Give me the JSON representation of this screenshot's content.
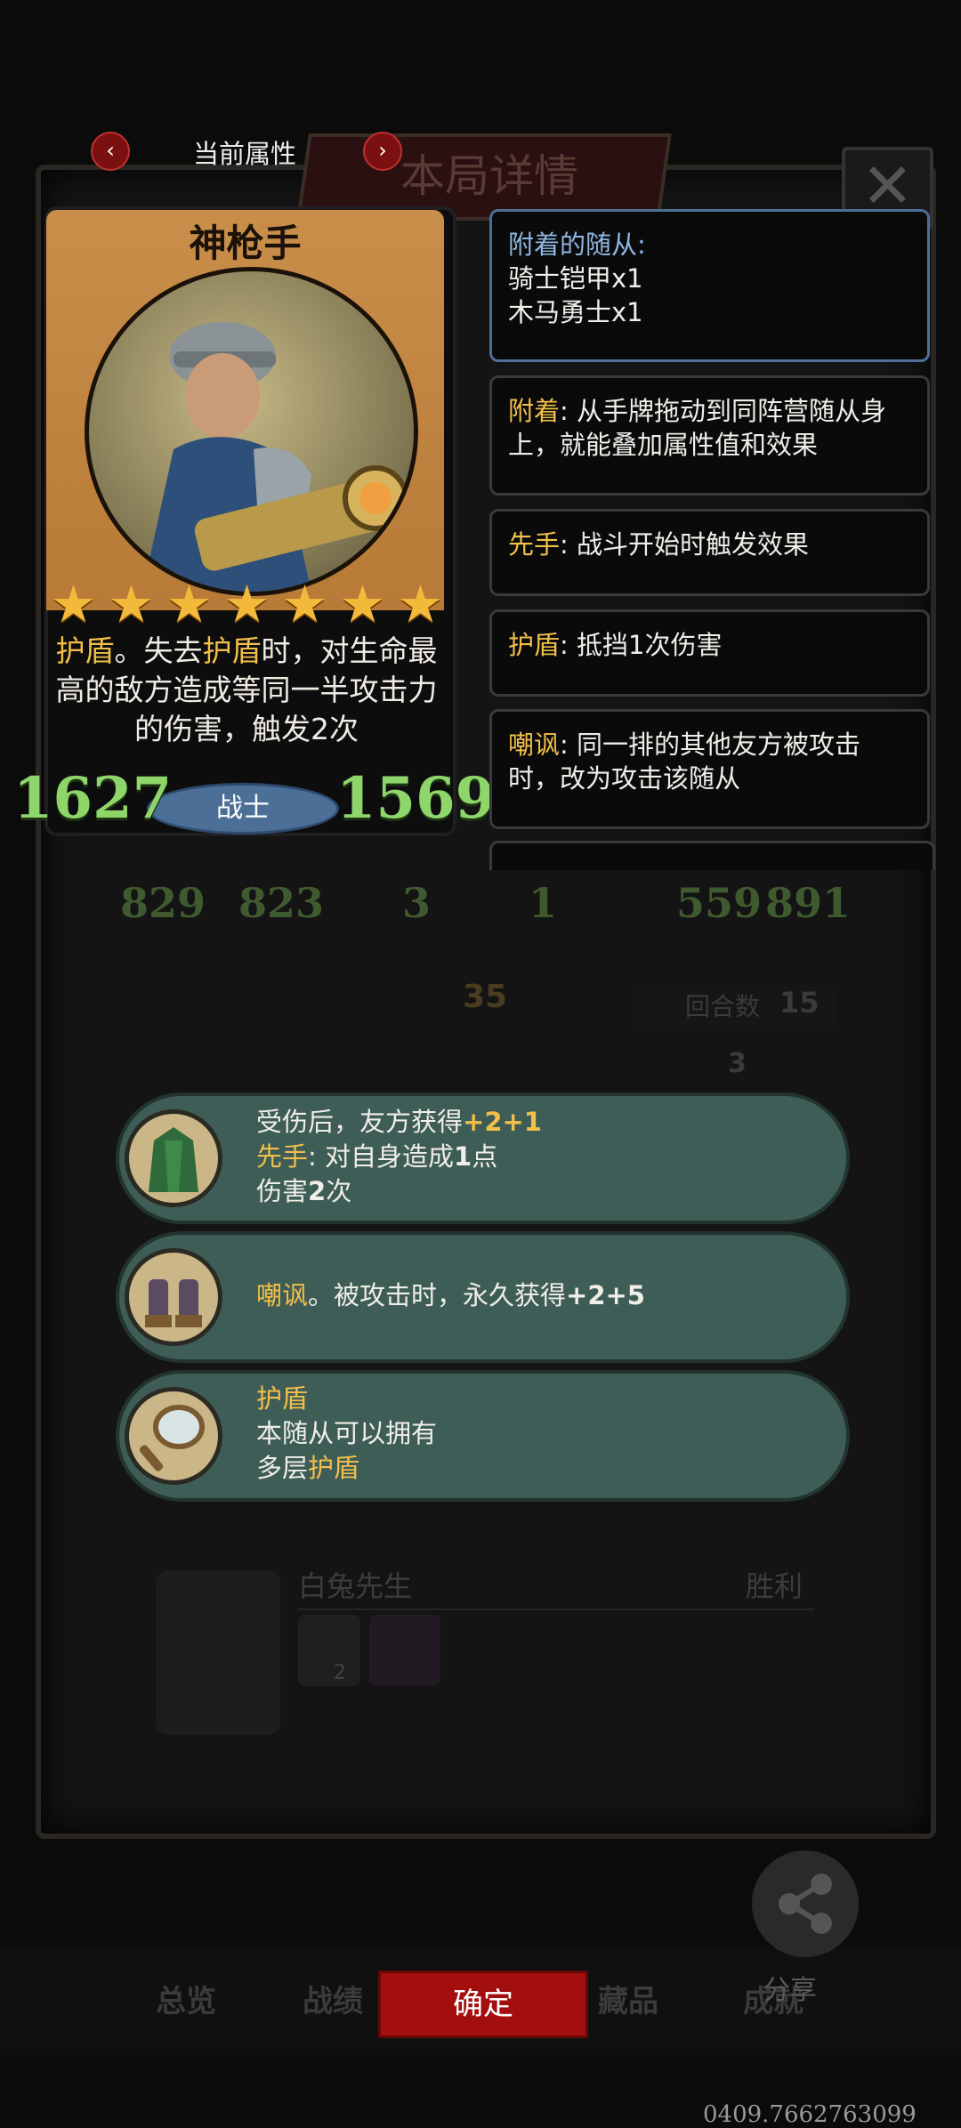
{
  "header": {
    "current_attr_label": "当前属性",
    "prev_arrow": "‹",
    "next_arrow": "›",
    "bg_title": "本局详情",
    "close_glyph": "✕"
  },
  "hero": {
    "name": "神枪手",
    "star_count": 7,
    "star_glyph": "★",
    "desc_parts": [
      "护盾",
      "。失去",
      "护盾",
      "时，对生命最高的敌方造成等同一半攻击力的伤害，触发2次"
    ],
    "attack": "1627",
    "tribe": "战士",
    "health": "1569"
  },
  "keyword_boxes": [
    {
      "title": "附着的随从:",
      "lines": [
        "骑士铠甲x1",
        "木马勇士x1"
      ]
    },
    {
      "keyword": "附着",
      "text": ": 从手牌拖动到同阵营随从身上，就能叠加属性值和效果"
    },
    {
      "keyword": "先手",
      "text": ": 战斗开始时触发效果"
    },
    {
      "keyword": "护盾",
      "text": ": 抵挡1次伤害"
    },
    {
      "keyword": "嘲讽",
      "text": ": 同一排的其他友方被攻击时，改为攻击该随从"
    }
  ],
  "background_board": {
    "row1": [
      "829",
      "823",
      "3",
      "1",
      "559",
      "891"
    ],
    "turn_label": "回合数",
    "turn_value": "15",
    "center_value": "35",
    "badge_value": "3",
    "enemy_name": "白兔先生",
    "result": "胜利",
    "badge_small": "2"
  },
  "effects": [
    {
      "lines": [
        [
          "",
          "受伤后，友方获得"
        ],
        [
          "kw",
          "+2+1"
        ]
      ],
      "line2": [
        [
          "hl",
          "先手"
        ],
        [
          "",
          ": 对自身造成"
        ],
        [
          "kw",
          "1"
        ],
        [
          "",
          "点"
        ]
      ],
      "line3": [
        [
          "",
          "伤害"
        ],
        [
          "kw",
          "2"
        ],
        [
          "",
          "次"
        ]
      ],
      "icon": "cloak-icon"
    },
    {
      "line1": [
        [
          "hl",
          "嘲讽"
        ],
        [
          "",
          "。被攻击时，永久获得"
        ],
        [
          "kw",
          "+2+5"
        ]
      ],
      "icon": "gauntlet-icon"
    },
    {
      "line1": [
        [
          "hl",
          "护盾"
        ]
      ],
      "line2": [
        [
          "",
          "本随从可以拥有"
        ]
      ],
      "line3": [
        [
          "",
          "多层"
        ],
        [
          "hl",
          "护盾"
        ]
      ],
      "icon": "mirror-icon"
    }
  ],
  "tabs": [
    "总览",
    "战绩",
    "藏品",
    "成就"
  ],
  "confirm_label": "确定",
  "share_label": "分享",
  "footer_number": "0409.7662763099",
  "colors": {
    "accent_red": "#a30f0f",
    "keyword_gold": "#f2c04a",
    "stat_green": "#8fd66a",
    "pill_green": "#3e5d57"
  }
}
